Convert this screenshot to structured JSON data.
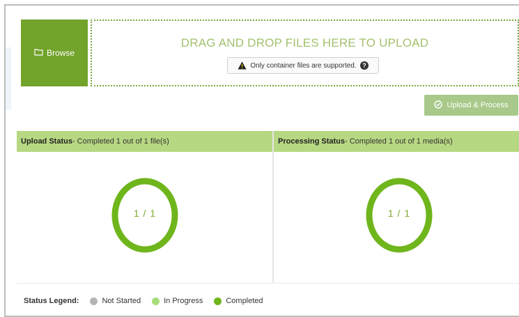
{
  "browse": {
    "label": "Browse",
    "icon": "folder-icon"
  },
  "dropzone": {
    "title": "DRAG AND DROP FILES HERE TO UPLOAD",
    "note": "Only container files are supported.",
    "note_icon": "warning-icon",
    "help_icon": "help-icon"
  },
  "upload_button": {
    "label": "Upload & Process",
    "icon": "check-circle-icon"
  },
  "upload_status": {
    "title": "Upload Status",
    "summary": " - Completed 1 out of 1 file(s)",
    "ring_label": "1 / 1",
    "progress": 1.0
  },
  "processing_status": {
    "title": "Processing Status",
    "summary": " - Completed 1 out of 1 media(s)",
    "ring_label": "1 / 1",
    "progress": 1.0
  },
  "legend": {
    "title": "Status Legend:",
    "items": [
      {
        "label": "Not Started",
        "color": "#b5b5b5"
      },
      {
        "label": "In Progress",
        "color": "#a9dd7a"
      },
      {
        "label": "Completed",
        "color": "#6fb51c"
      }
    ]
  },
  "colors": {
    "brand_green": "#72a32b",
    "ring_green": "#6fb51c",
    "header_green": "#b7d882"
  }
}
